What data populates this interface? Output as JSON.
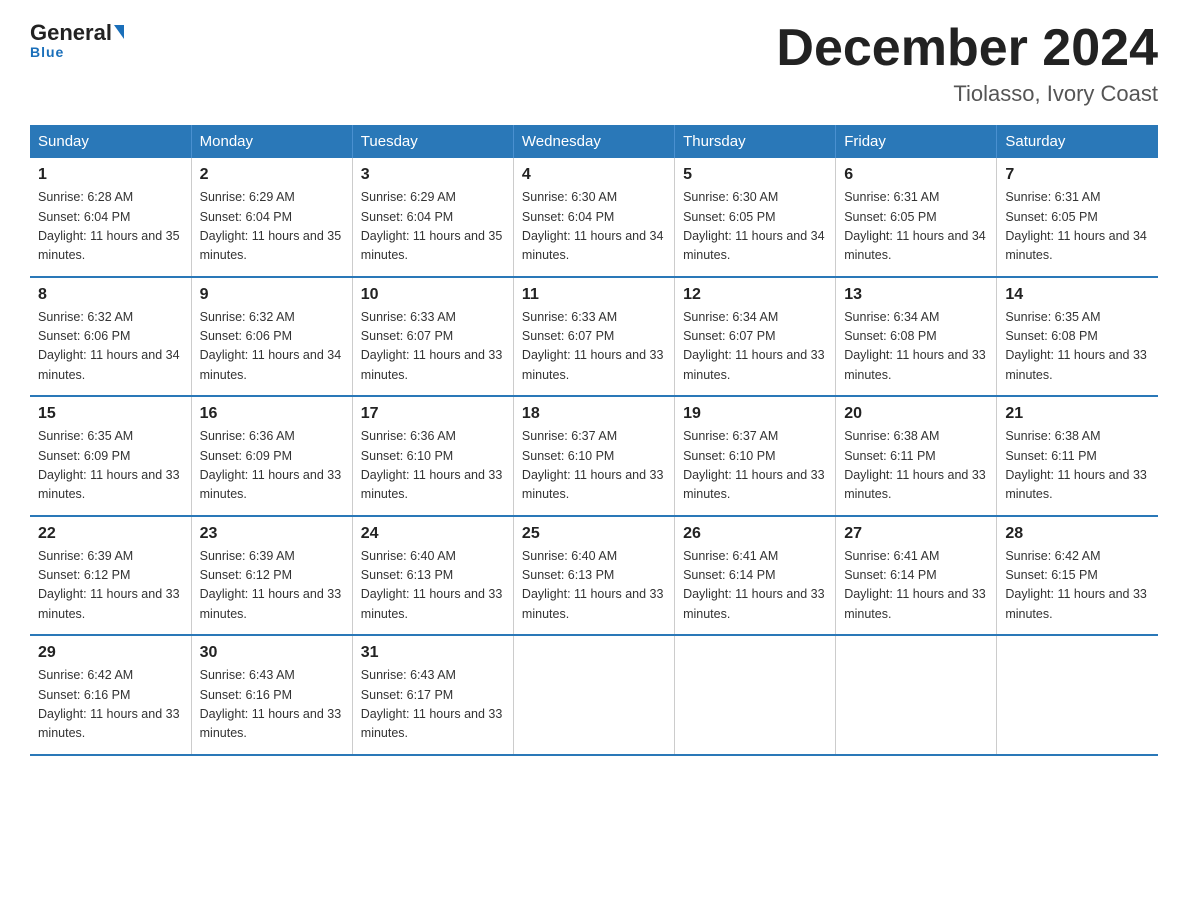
{
  "logo": {
    "general": "General",
    "blue_word": "Blue",
    "tagline": "Blue"
  },
  "header": {
    "month_year": "December 2024",
    "location": "Tiolasso, Ivory Coast"
  },
  "weekdays": [
    "Sunday",
    "Monday",
    "Tuesday",
    "Wednesday",
    "Thursday",
    "Friday",
    "Saturday"
  ],
  "weeks": [
    [
      {
        "day": "1",
        "sunrise": "6:28 AM",
        "sunset": "6:04 PM",
        "daylight": "11 hours and 35 minutes."
      },
      {
        "day": "2",
        "sunrise": "6:29 AM",
        "sunset": "6:04 PM",
        "daylight": "11 hours and 35 minutes."
      },
      {
        "day": "3",
        "sunrise": "6:29 AM",
        "sunset": "6:04 PM",
        "daylight": "11 hours and 35 minutes."
      },
      {
        "day": "4",
        "sunrise": "6:30 AM",
        "sunset": "6:04 PM",
        "daylight": "11 hours and 34 minutes."
      },
      {
        "day": "5",
        "sunrise": "6:30 AM",
        "sunset": "6:05 PM",
        "daylight": "11 hours and 34 minutes."
      },
      {
        "day": "6",
        "sunrise": "6:31 AM",
        "sunset": "6:05 PM",
        "daylight": "11 hours and 34 minutes."
      },
      {
        "day": "7",
        "sunrise": "6:31 AM",
        "sunset": "6:05 PM",
        "daylight": "11 hours and 34 minutes."
      }
    ],
    [
      {
        "day": "8",
        "sunrise": "6:32 AM",
        "sunset": "6:06 PM",
        "daylight": "11 hours and 34 minutes."
      },
      {
        "day": "9",
        "sunrise": "6:32 AM",
        "sunset": "6:06 PM",
        "daylight": "11 hours and 34 minutes."
      },
      {
        "day": "10",
        "sunrise": "6:33 AM",
        "sunset": "6:07 PM",
        "daylight": "11 hours and 33 minutes."
      },
      {
        "day": "11",
        "sunrise": "6:33 AM",
        "sunset": "6:07 PM",
        "daylight": "11 hours and 33 minutes."
      },
      {
        "day": "12",
        "sunrise": "6:34 AM",
        "sunset": "6:07 PM",
        "daylight": "11 hours and 33 minutes."
      },
      {
        "day": "13",
        "sunrise": "6:34 AM",
        "sunset": "6:08 PM",
        "daylight": "11 hours and 33 minutes."
      },
      {
        "day": "14",
        "sunrise": "6:35 AM",
        "sunset": "6:08 PM",
        "daylight": "11 hours and 33 minutes."
      }
    ],
    [
      {
        "day": "15",
        "sunrise": "6:35 AM",
        "sunset": "6:09 PM",
        "daylight": "11 hours and 33 minutes."
      },
      {
        "day": "16",
        "sunrise": "6:36 AM",
        "sunset": "6:09 PM",
        "daylight": "11 hours and 33 minutes."
      },
      {
        "day": "17",
        "sunrise": "6:36 AM",
        "sunset": "6:10 PM",
        "daylight": "11 hours and 33 minutes."
      },
      {
        "day": "18",
        "sunrise": "6:37 AM",
        "sunset": "6:10 PM",
        "daylight": "11 hours and 33 minutes."
      },
      {
        "day": "19",
        "sunrise": "6:37 AM",
        "sunset": "6:10 PM",
        "daylight": "11 hours and 33 minutes."
      },
      {
        "day": "20",
        "sunrise": "6:38 AM",
        "sunset": "6:11 PM",
        "daylight": "11 hours and 33 minutes."
      },
      {
        "day": "21",
        "sunrise": "6:38 AM",
        "sunset": "6:11 PM",
        "daylight": "11 hours and 33 minutes."
      }
    ],
    [
      {
        "day": "22",
        "sunrise": "6:39 AM",
        "sunset": "6:12 PM",
        "daylight": "11 hours and 33 minutes."
      },
      {
        "day": "23",
        "sunrise": "6:39 AM",
        "sunset": "6:12 PM",
        "daylight": "11 hours and 33 minutes."
      },
      {
        "day": "24",
        "sunrise": "6:40 AM",
        "sunset": "6:13 PM",
        "daylight": "11 hours and 33 minutes."
      },
      {
        "day": "25",
        "sunrise": "6:40 AM",
        "sunset": "6:13 PM",
        "daylight": "11 hours and 33 minutes."
      },
      {
        "day": "26",
        "sunrise": "6:41 AM",
        "sunset": "6:14 PM",
        "daylight": "11 hours and 33 minutes."
      },
      {
        "day": "27",
        "sunrise": "6:41 AM",
        "sunset": "6:14 PM",
        "daylight": "11 hours and 33 minutes."
      },
      {
        "day": "28",
        "sunrise": "6:42 AM",
        "sunset": "6:15 PM",
        "daylight": "11 hours and 33 minutes."
      }
    ],
    [
      {
        "day": "29",
        "sunrise": "6:42 AM",
        "sunset": "6:16 PM",
        "daylight": "11 hours and 33 minutes."
      },
      {
        "day": "30",
        "sunrise": "6:43 AM",
        "sunset": "6:16 PM",
        "daylight": "11 hours and 33 minutes."
      },
      {
        "day": "31",
        "sunrise": "6:43 AM",
        "sunset": "6:17 PM",
        "daylight": "11 hours and 33 minutes."
      },
      null,
      null,
      null,
      null
    ]
  ]
}
